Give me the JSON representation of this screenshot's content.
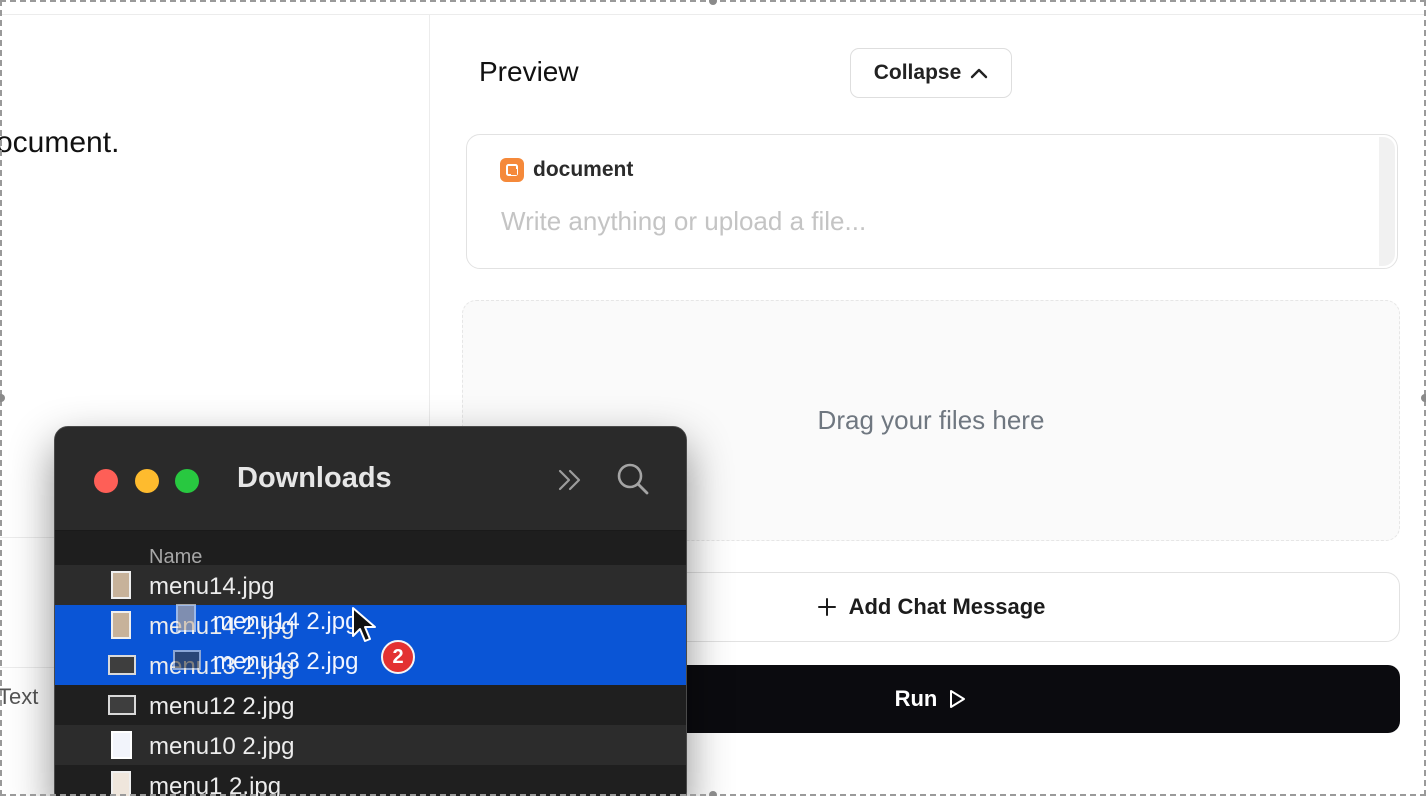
{
  "canvas": {
    "left_text": "ocument.",
    "left_tab_label": "Text"
  },
  "preview": {
    "title": "Preview",
    "collapse_label": "Collapse",
    "document_label": "document",
    "document_placeholder": "Write anything or upload a file...",
    "dropzone_text": "Drag your files here",
    "add_message_label": "Add Chat Message",
    "run_label": "Run"
  },
  "finder": {
    "title": "Downloads",
    "column_name": "Name",
    "rows": [
      {
        "label": "menu14.jpg",
        "thumb": "tall",
        "selected": false
      },
      {
        "label": "menu14 2.jpg",
        "thumb": "tall",
        "selected": true
      },
      {
        "label": "menu13 2.jpg",
        "thumb": "wide",
        "selected": true
      },
      {
        "label": "menu12 2.jpg",
        "thumb": "wide",
        "selected": false
      },
      {
        "label": "menu10 2.jpg",
        "thumb": "doc",
        "selected": false
      },
      {
        "label": "menu1 2.jpg",
        "thumb": "tall",
        "selected": false
      }
    ]
  },
  "drag": {
    "items": [
      "menu14 2.jpg",
      "menu13 2.jpg"
    ],
    "count_badge": "2"
  },
  "colors": {
    "accent_orange": "#f5893a",
    "selection_blue": "#0a55d6",
    "run_button": "#0b0b0f",
    "badge_red": "#e33131"
  },
  "icons": [
    "chevron-up-icon",
    "document-icon",
    "plus-icon",
    "play-icon",
    "close-window-icon",
    "minimize-window-icon",
    "zoom-window-icon",
    "more-chevrons-icon",
    "search-icon",
    "image-file-icon",
    "pointer-cursor-icon"
  ]
}
